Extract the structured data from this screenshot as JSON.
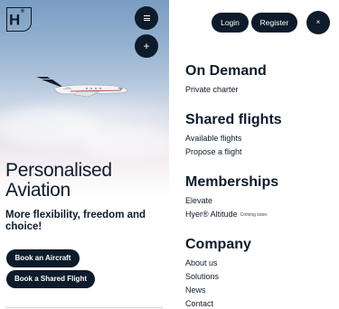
{
  "hero": {
    "logo_text": "H",
    "logo_mark": "®",
    "menu_icon": "hamburger-icon",
    "plus_icon": "plus-icon",
    "plus_glyph": "+",
    "headline_line1": "Personalised",
    "headline_line2": "Aviation",
    "subline": "More flexibility, freedom and choice!",
    "book_aircraft_label": "Book an Aircraft",
    "book_shared_label": "Book a Shared Flight"
  },
  "header": {
    "login_label": "Login",
    "register_label": "Register",
    "close_icon": "close-icon",
    "close_glyph": "×"
  },
  "menu": {
    "sections": [
      {
        "title": "On Demand",
        "links": [
          {
            "label": "Private charter"
          }
        ]
      },
      {
        "title": "Shared flights",
        "links": [
          {
            "label": "Available flights"
          },
          {
            "label": "Propose a flight"
          }
        ]
      },
      {
        "title": "Memberships",
        "links": [
          {
            "label": "Elevate"
          },
          {
            "label": "Hyer® Altitude",
            "badge": "Coming soon"
          }
        ]
      },
      {
        "title": "Company",
        "links": [
          {
            "label": "About us"
          },
          {
            "label": "Solutions"
          },
          {
            "label": "News"
          },
          {
            "label": "Contact"
          }
        ]
      }
    ]
  },
  "colors": {
    "brand_navy": "#0d1b2a",
    "sky_top": "#7b9dc2",
    "background": "#ffffff"
  }
}
